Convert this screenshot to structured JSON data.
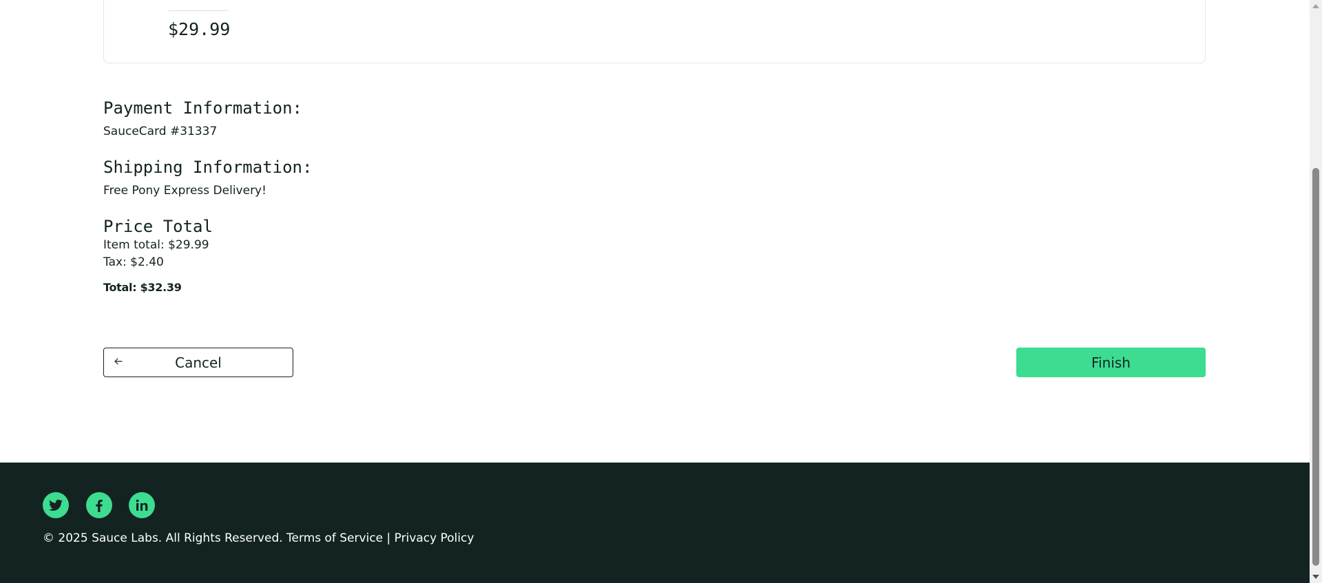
{
  "cart_item": {
    "price": "$29.99"
  },
  "summary": {
    "payment_label": "Payment Information:",
    "payment_value": "SauceCard #31337",
    "shipping_label": "Shipping Information:",
    "shipping_value": "Free Pony Express Delivery!",
    "total_label": "Price Total",
    "subtotal": "Item total: $29.99",
    "tax": "Tax: $2.40",
    "total": "Total: $32.39"
  },
  "actions": {
    "cancel_label": "Cancel",
    "cancel_icon": "arrow-left-icon",
    "finish_label": "Finish"
  },
  "footer": {
    "social": [
      "twitter-icon",
      "facebook-icon",
      "linkedin-icon"
    ],
    "copyright": "© 2025 Sauce Labs. All Rights Reserved. Terms of Service | Privacy Policy"
  },
  "colors": {
    "accent": "#3ddc91",
    "footer_bg": "#132322",
    "text": "#132322"
  }
}
